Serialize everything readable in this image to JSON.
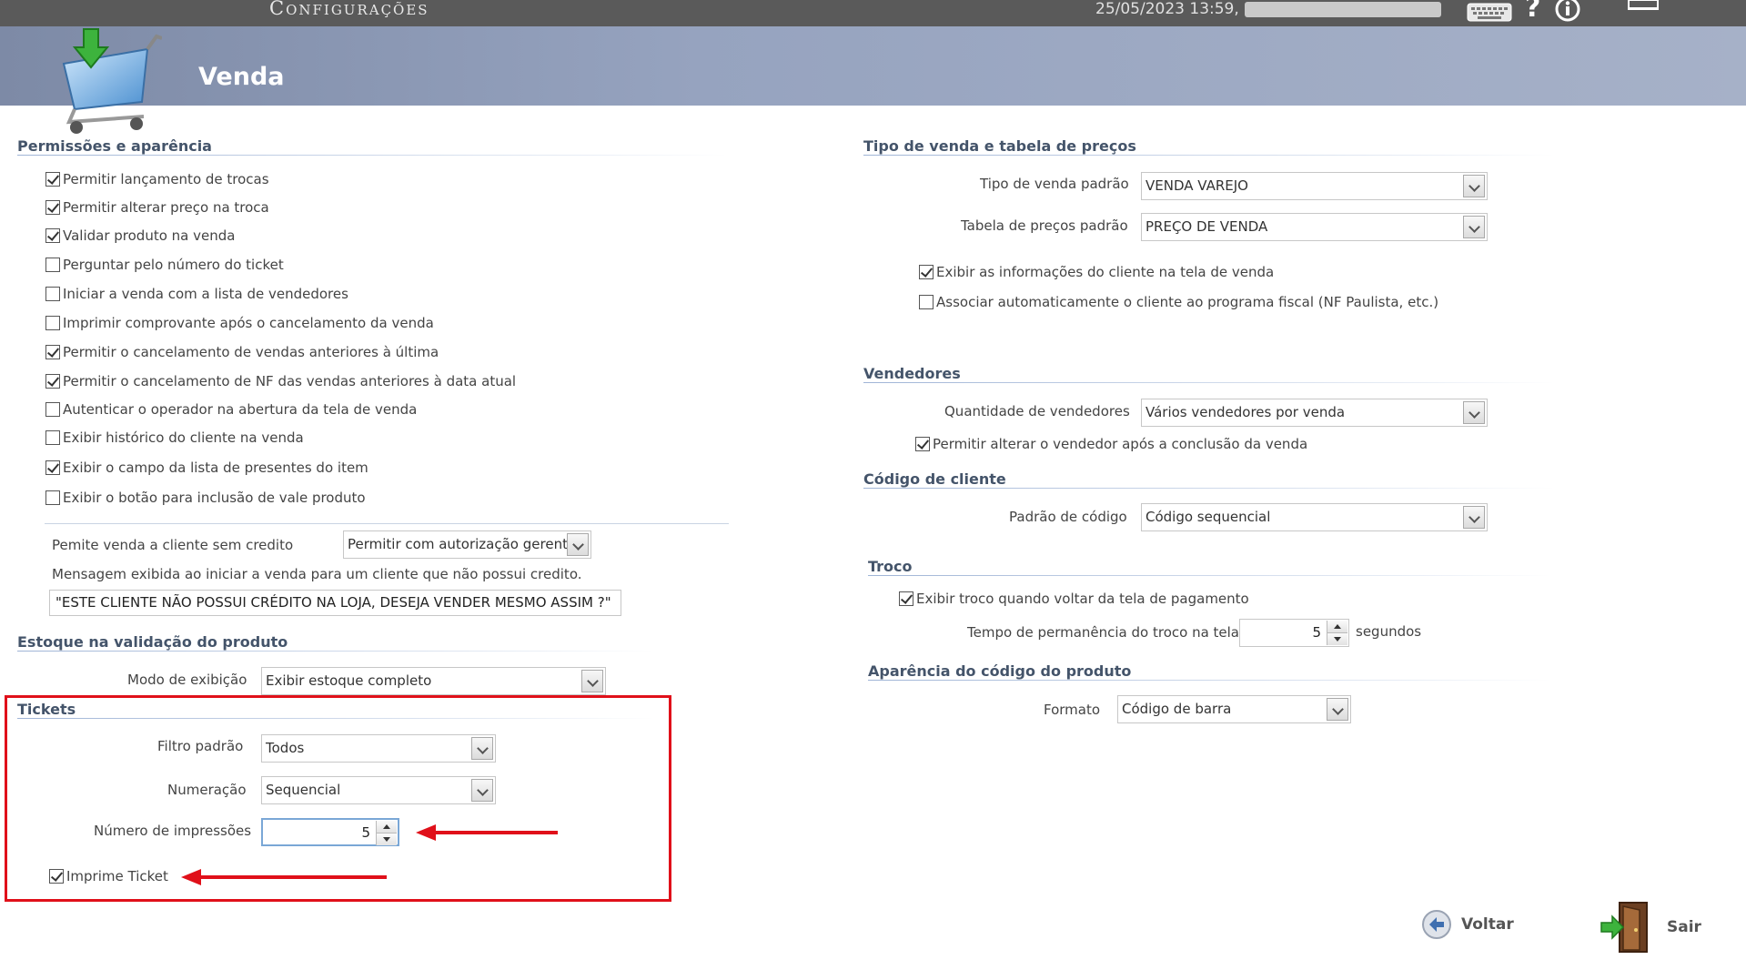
{
  "topbar": {
    "app_title": "Configurações",
    "datetime": "25/05/2023 13:59,",
    "icons": [
      "keyboard-icon",
      "help-icon",
      "info-icon",
      "minimize-icon"
    ]
  },
  "header": {
    "title": "Venda",
    "icon": "shopping-cart-icon"
  },
  "permissoes": {
    "title": "Permissões e aparência",
    "items": [
      {
        "label": "Permitir lançamento de trocas",
        "checked": true
      },
      {
        "label": "Permitir alterar preço na troca",
        "checked": true
      },
      {
        "label": "Validar produto na venda",
        "checked": true
      },
      {
        "label": "Perguntar pelo número do ticket",
        "checked": false
      },
      {
        "label": "Iniciar a venda com a lista de vendedores",
        "checked": false
      },
      {
        "label": "Imprimir comprovante após o cancelamento da venda",
        "checked": false
      },
      {
        "label": "Permitir o cancelamento de vendas anteriores à última",
        "checked": true
      },
      {
        "label": "Permitir o cancelamento de NF das vendas anteriores à data atual",
        "checked": true
      },
      {
        "label": "Autenticar o operador na abertura da tela de venda",
        "checked": false
      },
      {
        "label": "Exibir histórico do cliente na venda",
        "checked": false
      },
      {
        "label": "Exibir o campo da lista de presentes do item",
        "checked": true
      },
      {
        "label": "Exibir o botão para inclusão de vale produto",
        "checked": false
      }
    ],
    "credito_label": "Pemite venda a cliente sem credito",
    "credito_value": "Permitir com autorização gerente",
    "mensagem_label": "Mensagem exibida ao iniciar a venda para um cliente que não possui credito.",
    "mensagem_value": "\"ESTE CLIENTE NÃO POSSUI CRÉDITO NA LOJA, DESEJA VENDER MESMO ASSIM ?\""
  },
  "estoque": {
    "title": "Estoque na validação do produto",
    "modo_label": "Modo de exibição",
    "modo_value": "Exibir estoque completo"
  },
  "tickets": {
    "title": "Tickets",
    "filtro_label": "Filtro padrão",
    "filtro_value": "Todos",
    "numeracao_label": "Numeração",
    "numeracao_value": "Sequencial",
    "impressoes_label": "Número de impressões",
    "impressoes_value": "5",
    "imprime_label": "Imprime Ticket",
    "imprime_checked": true
  },
  "tipo_venda": {
    "title": "Tipo de venda e tabela de preços",
    "tipo_label": "Tipo de venda padrão",
    "tipo_value": "VENDA VAREJO",
    "tabela_label": "Tabela de preços padrão",
    "tabela_value": "PREÇO DE VENDA",
    "exibir_info_label": "Exibir as informações do cliente na tela de venda",
    "exibir_info_checked": true,
    "associar_label": "Associar automaticamente o cliente ao programa fiscal (NF Paulista, etc.)",
    "associar_checked": false
  },
  "vendedores": {
    "title": "Vendedores",
    "quantidade_label": "Quantidade de vendedores",
    "quantidade_value": "Vários vendedores por venda",
    "permitir_label": "Permitir alterar o vendedor após a conclusão da venda",
    "permitir_checked": true
  },
  "codigo_cliente": {
    "title": "Código de cliente",
    "padrao_label": "Padrão de código",
    "padrao_value": "Código sequencial"
  },
  "troco": {
    "title": "Troco",
    "exibir_label": "Exibir troco quando voltar da tela de pagamento",
    "exibir_checked": true,
    "tempo_label": "Tempo de permanência do troco na tela",
    "tempo_value": "5",
    "tempo_unit": "segundos"
  },
  "aparencia": {
    "title": "Aparência do código do produto",
    "formato_label": "Formato",
    "formato_value": "Código de barra"
  },
  "footer": {
    "voltar_label": "Voltar",
    "sair_label": "Sair"
  },
  "colors": {
    "highlight": "#e0101a",
    "header": "#96a3bf",
    "section_title": "#44546a"
  }
}
